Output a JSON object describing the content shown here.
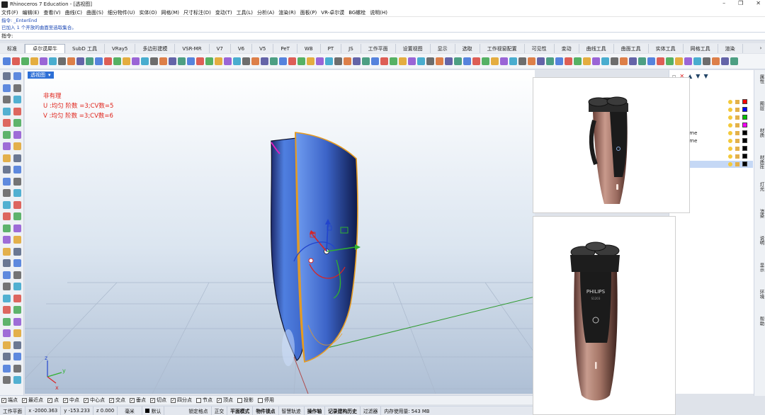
{
  "window": {
    "title": "Rhinoceros 7 Education - [透视图]",
    "controls": [
      "–",
      "❐",
      "✕"
    ]
  },
  "menu": [
    "文件(F)",
    "编辑(E)",
    "查看(V)",
    "曲线(C)",
    "曲面(S)",
    "细分物件(U)",
    "实体(O)",
    "网格(M)",
    "尺寸标注(D)",
    "变动(T)",
    "工具(L)",
    "分析(A)",
    "渲染(R)",
    "面板(P)",
    "VR-卓尔谟",
    "BG螺栓",
    "说明(H)"
  ],
  "command": {
    "history": [
      "指令: _EnterEnd",
      "已加入 1 个开放的曲面至选取集合。"
    ],
    "prompt": "指令:"
  },
  "tabs": [
    "标准",
    "卓尔谟犀牛",
    "SubD 工具",
    "VRay5",
    "多边形建模",
    "VSR-MR",
    "V7",
    "V6",
    "V5",
    "PeT",
    "WB",
    "PT",
    "JS",
    "工作平面",
    "设置视图",
    "显示",
    "选取",
    "工作视窗配置",
    "可见性",
    "变动",
    "曲线工具",
    "曲面工具",
    "实体工具",
    "网格工具",
    "渲染"
  ],
  "active_tab": "卓尔谟犀牛",
  "viewport": {
    "name": "透视图",
    "info_lines": [
      "非有理",
      "U :均匀  阶数 =3;CV数=5",
      "V :均匀  阶数 =3;CV数=6"
    ],
    "axes": {
      "x": "x",
      "y": "y",
      "z": "z"
    }
  },
  "layers": [
    {
      "name": "",
      "swatch": "#ff0000"
    },
    {
      "name": "",
      "swatch": "#0000ff"
    },
    {
      "name": "",
      "swatch": "#00c000"
    },
    {
      "name": "",
      "swatch": "#ff00ff"
    },
    {
      "name": "ome",
      "swatch": "#000000"
    },
    {
      "name": "ome",
      "swatch": "#000000"
    },
    {
      "name": "",
      "swatch": "#000000"
    },
    {
      "name": "",
      "swatch": "#000000"
    },
    {
      "name": "",
      "swatch": "#000000"
    }
  ],
  "side_tabs": [
    "属性",
    "图层",
    "材质",
    "材质库",
    "灯光",
    "渲染",
    "说明",
    "显示",
    "环境",
    "帮助"
  ],
  "osnaps": [
    {
      "label": "端点",
      "checked": true
    },
    {
      "label": "最近点",
      "checked": true
    },
    {
      "label": "点",
      "checked": true
    },
    {
      "label": "中点",
      "checked": true
    },
    {
      "label": "中心点",
      "checked": true
    },
    {
      "label": "交点",
      "checked": true
    },
    {
      "label": "垂点",
      "checked": true
    },
    {
      "label": "切点",
      "checked": true
    },
    {
      "label": "四分点",
      "checked": true
    },
    {
      "label": "节点",
      "checked": false
    },
    {
      "label": "顶点",
      "checked": true
    },
    {
      "label": "投影",
      "checked": false
    },
    {
      "label": "停用",
      "checked": false
    }
  ],
  "status": {
    "plane": "工作平面",
    "x": "x -2000.363",
    "y": "y -153.233",
    "z": "z 0.000",
    "unit": "毫米",
    "layer": "默认",
    "toggles": [
      "锁定格点",
      "正交",
      "平面模式",
      "物件锁点",
      "智慧轨迹",
      "操作轴",
      "记录建构历史",
      "过滤器"
    ],
    "memory": "内存使用量: 543 MB"
  },
  "product": {
    "brand": "PHILIPS",
    "model": "S1203"
  }
}
